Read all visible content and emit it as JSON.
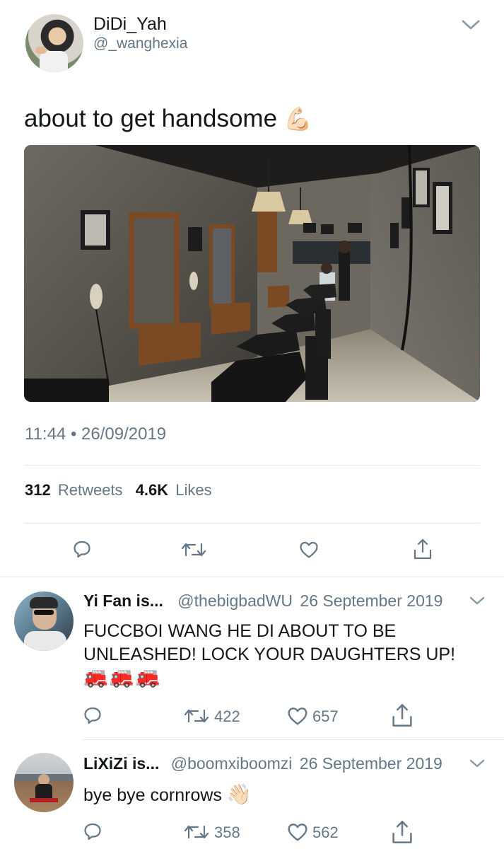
{
  "tweet": {
    "display_name": "DiDi_Yah",
    "handle": "@_wanghexia",
    "text": "about to get handsome",
    "emoji": "💪🏻",
    "timestamp": "11:44 • 26/09/2019",
    "retweets_count": "312",
    "retweets_label": "Retweets",
    "likes_count": "4.6K",
    "likes_label": "Likes"
  },
  "replies": [
    {
      "display_name": "Yi Fan is...",
      "handle": "@thebigbadWU",
      "date": "26 September 2019",
      "text": "FUCCBOI WANG HE DI ABOUT TO BE UNLEASHED! LOCK YOUR DAUGHTERS UP!",
      "emoji": "🚒🚒🚒",
      "retweets": "422",
      "likes": "657"
    },
    {
      "display_name": "LiXiZi is...",
      "handle": "@boomxiboomzi",
      "date": "26 September 2019",
      "text": "bye bye cornrows",
      "emoji": "👋🏻",
      "retweets": "358",
      "likes": "562"
    }
  ],
  "icons": {
    "reply": "reply-icon",
    "retweet": "retweet-icon",
    "like": "like-icon",
    "share": "share-icon",
    "chevron": "chevron-down-icon"
  },
  "colors": {
    "text": "#14171a",
    "muted": "#657786",
    "divider": "#e1e8ed"
  }
}
